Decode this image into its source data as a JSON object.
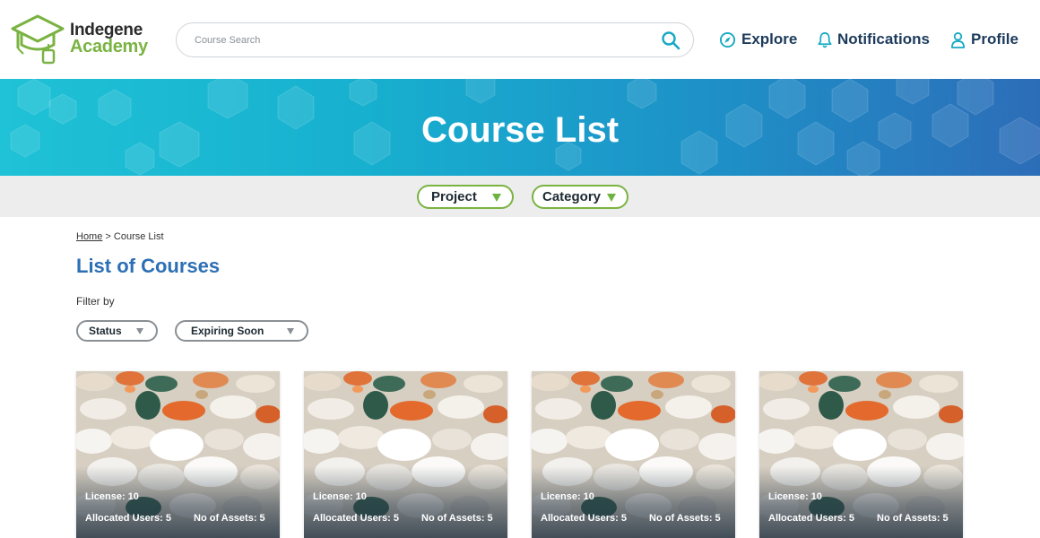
{
  "header": {
    "logo": {
      "line1": "Indegene",
      "line2": "Academy",
      "icon": "graduation-cap-tag-icon",
      "brand_color": "#7ab342"
    },
    "search": {
      "placeholder": "Course Search",
      "value": "",
      "icon": "search-icon"
    },
    "nav": [
      {
        "label": "Explore",
        "icon": "compass-icon"
      },
      {
        "label": "Notifications",
        "icon": "bell-icon"
      },
      {
        "label": "Profile",
        "icon": "user-icon"
      }
    ]
  },
  "banner": {
    "title": "Course List"
  },
  "top_filters": {
    "project_label": "Project",
    "category_label": "Category"
  },
  "breadcrumb": {
    "home": "Home",
    "separator": " > ",
    "current": "Course List"
  },
  "page": {
    "title": "List of Courses",
    "filter_by_label": "Filter by"
  },
  "filters": {
    "status_label": "Status",
    "expiring_label": "Expiring Soon"
  },
  "cards": [
    {
      "license": "License: 10",
      "allocated": "Allocated Users: 5",
      "assets": "No of Assets: 5"
    },
    {
      "license": "License: 10",
      "allocated": "Allocated Users: 5",
      "assets": "No of Assets: 5"
    },
    {
      "license": "License: 10",
      "allocated": "Allocated Users: 5",
      "assets": "No of Assets: 5"
    },
    {
      "license": "License: 10",
      "allocated": "Allocated Users: 5",
      "assets": "No of Assets: 5"
    }
  ],
  "colors": {
    "accent_blue": "#2c6fb5",
    "accent_green": "#7ab342",
    "nav_text": "#1d3b5c",
    "icon_teal": "#16a9c4"
  }
}
